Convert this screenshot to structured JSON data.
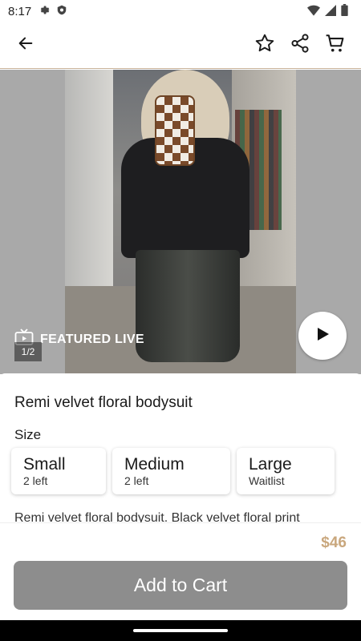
{
  "status_bar": {
    "time": "8:17",
    "left_icons": [
      "gear-icon",
      "shield-icon"
    ],
    "right_icons": [
      "wifi-icon",
      "signal-icon",
      "battery-icon"
    ]
  },
  "app_bar": {
    "icons": [
      "back-arrow-icon",
      "star-icon",
      "share-icon",
      "cart-icon"
    ]
  },
  "hero": {
    "featured_label": "FEATURED LIVE",
    "page_indicator": "1/2"
  },
  "product": {
    "title": "Remi velvet floral bodysuit",
    "size_label": "Size",
    "sizes": [
      {
        "name": "Small",
        "availability": "2 left"
      },
      {
        "name": "Medium",
        "availability": "2 left"
      },
      {
        "name": "Large",
        "availability": "Waitlist"
      }
    ],
    "description": "Remi velvet floral bodysuit. Black velvet floral print"
  },
  "footer": {
    "price": "$46",
    "add_to_cart_label": "Add to Cart"
  },
  "colors": {
    "accent": "#c9a77d",
    "button_disabled": "#8d8d8d"
  }
}
